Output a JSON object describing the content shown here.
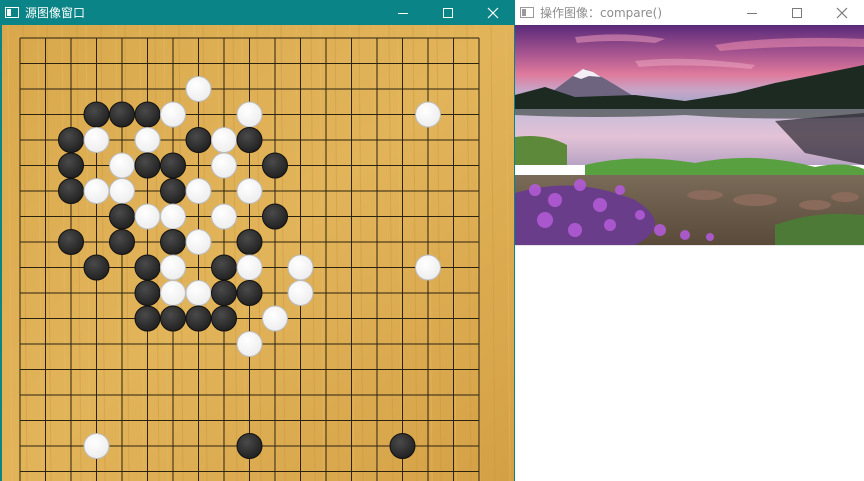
{
  "left_window": {
    "title": "源图像窗口",
    "buttons": {
      "minimize": "minimize-icon",
      "maximize": "maximize-icon",
      "close": "close-icon"
    }
  },
  "right_window": {
    "title": "操作图像：compare()",
    "buttons": {
      "minimize": "minimize-icon",
      "maximize": "maximize-icon",
      "close": "close-icon"
    }
  },
  "colors": {
    "title_bar_active": "#0a8486",
    "board_wood": "#d9a84c",
    "black_stone": "#2a2a2a",
    "white_stone": "#ffffff"
  },
  "board": {
    "grid_size": 19,
    "stones": [
      {
        "color": "white",
        "col": 7,
        "row": 2
      },
      {
        "color": "white",
        "col": 9,
        "row": 3
      },
      {
        "color": "white",
        "col": 16,
        "row": 3
      },
      {
        "color": "black",
        "col": 3,
        "row": 3
      },
      {
        "color": "black",
        "col": 4,
        "row": 3
      },
      {
        "color": "black",
        "col": 5,
        "row": 3
      },
      {
        "color": "white",
        "col": 6,
        "row": 3
      },
      {
        "color": "black",
        "col": 2,
        "row": 4
      },
      {
        "color": "white",
        "col": 3,
        "row": 4
      },
      {
        "color": "white",
        "col": 5,
        "row": 4
      },
      {
        "color": "black",
        "col": 7,
        "row": 4
      },
      {
        "color": "white",
        "col": 8,
        "row": 4
      },
      {
        "color": "black",
        "col": 9,
        "row": 4
      },
      {
        "color": "black",
        "col": 2,
        "row": 5
      },
      {
        "color": "white",
        "col": 4,
        "row": 5
      },
      {
        "color": "black",
        "col": 5,
        "row": 5
      },
      {
        "color": "black",
        "col": 6,
        "row": 5
      },
      {
        "color": "white",
        "col": 8,
        "row": 5
      },
      {
        "color": "black",
        "col": 10,
        "row": 5
      },
      {
        "color": "black",
        "col": 2,
        "row": 6
      },
      {
        "color": "white",
        "col": 3,
        "row": 6
      },
      {
        "color": "white",
        "col": 4,
        "row": 6
      },
      {
        "color": "black",
        "col": 6,
        "row": 6
      },
      {
        "color": "white",
        "col": 7,
        "row": 6
      },
      {
        "color": "white",
        "col": 9,
        "row": 6
      },
      {
        "color": "black",
        "col": 4,
        "row": 7
      },
      {
        "color": "white",
        "col": 5,
        "row": 7
      },
      {
        "color": "white",
        "col": 6,
        "row": 7
      },
      {
        "color": "white",
        "col": 8,
        "row": 7
      },
      {
        "color": "black",
        "col": 10,
        "row": 7
      },
      {
        "color": "black",
        "col": 2,
        "row": 8
      },
      {
        "color": "black",
        "col": 4,
        "row": 8
      },
      {
        "color": "black",
        "col": 6,
        "row": 8
      },
      {
        "color": "white",
        "col": 7,
        "row": 8
      },
      {
        "color": "black",
        "col": 9,
        "row": 8
      },
      {
        "color": "black",
        "col": 3,
        "row": 9
      },
      {
        "color": "black",
        "col": 5,
        "row": 9
      },
      {
        "color": "white",
        "col": 6,
        "row": 9
      },
      {
        "color": "black",
        "col": 8,
        "row": 9
      },
      {
        "color": "white",
        "col": 9,
        "row": 9
      },
      {
        "color": "white",
        "col": 11,
        "row": 9
      },
      {
        "color": "white",
        "col": 16,
        "row": 9
      },
      {
        "color": "black",
        "col": 5,
        "row": 10
      },
      {
        "color": "white",
        "col": 6,
        "row": 10
      },
      {
        "color": "white",
        "col": 7,
        "row": 10
      },
      {
        "color": "black",
        "col": 8,
        "row": 10
      },
      {
        "color": "black",
        "col": 9,
        "row": 10
      },
      {
        "color": "white",
        "col": 11,
        "row": 10
      },
      {
        "color": "black",
        "col": 5,
        "row": 11
      },
      {
        "color": "black",
        "col": 6,
        "row": 11
      },
      {
        "color": "black",
        "col": 7,
        "row": 11
      },
      {
        "color": "black",
        "col": 8,
        "row": 11
      },
      {
        "color": "white",
        "col": 10,
        "row": 11
      },
      {
        "color": "white",
        "col": 9,
        "row": 12
      },
      {
        "color": "white",
        "col": 3,
        "row": 16
      },
      {
        "color": "black",
        "col": 9,
        "row": 16
      },
      {
        "color": "black",
        "col": 15,
        "row": 16
      }
    ]
  }
}
